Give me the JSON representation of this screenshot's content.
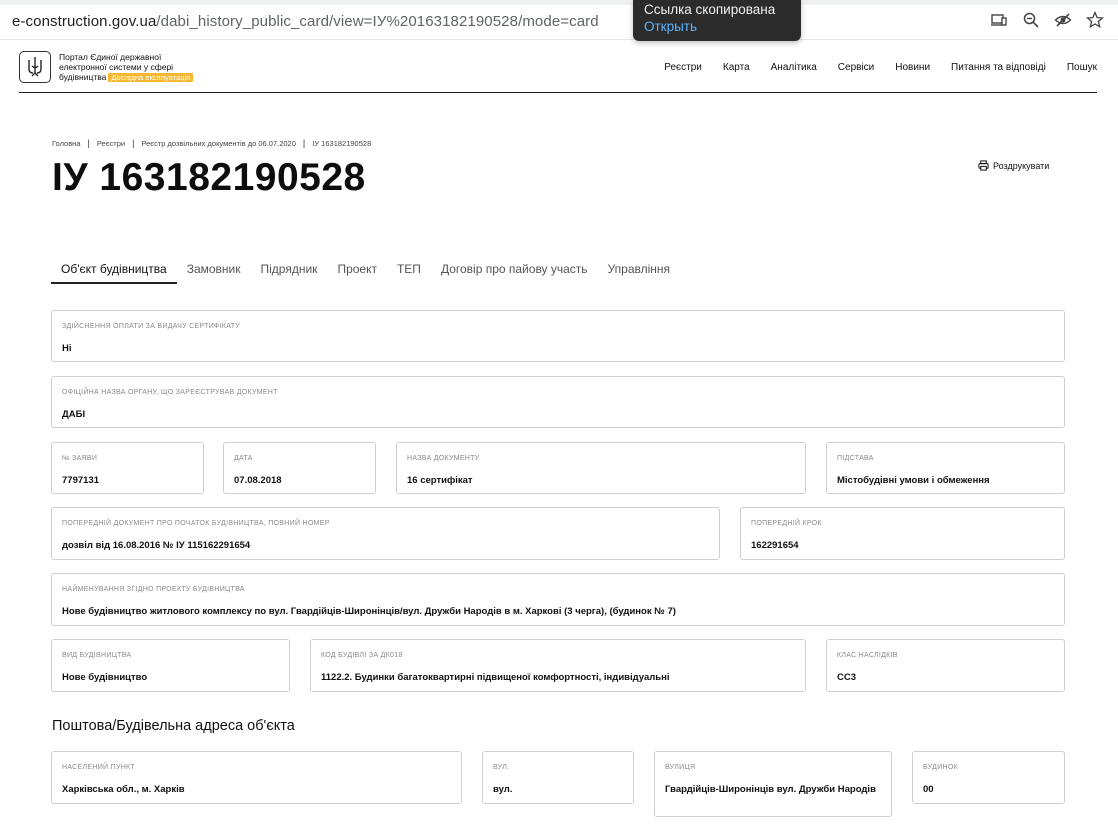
{
  "browser": {
    "url_host": "e-construction.gov.ua",
    "url_path": "/dabi_history_public_card/view=ІУ%20163182190528/mode=card",
    "toast": {
      "message": "Ссылка скопирована",
      "action": "Открыть"
    }
  },
  "header": {
    "portal_line1": "Портал Єдиної державної",
    "portal_line2": "електронної системи у сфері",
    "portal_line3": "будівництва",
    "badge": "Дослідна експлуатація",
    "nav": [
      "Реєстри",
      "Карта",
      "Аналітика",
      "Сервіси",
      "Новини",
      "Питання та відповіді",
      "Пошук"
    ]
  },
  "breadcrumb": [
    "Головна",
    "Реєстри",
    "Реєстр дозвільних документів до 06.07.2020",
    "ІУ 163182190528"
  ],
  "page_title": "ІУ 163182190528",
  "print_label": "Роздрукувати",
  "tabs": [
    "Об'єкт будівництва",
    "Замовник",
    "Підрядник",
    "Проект",
    "ТЕП",
    "Договір про пайову участь",
    "Управління"
  ],
  "fields": {
    "payment": {
      "label": "Здійснення оплати за видачу сертифікату",
      "value": "Ні"
    },
    "authority": {
      "label": "Офіційна назва органу, що зареєстрував документ",
      "value": "ДАБІ"
    },
    "application_no": {
      "label": "№ заяви",
      "value": "7797131"
    },
    "date": {
      "label": "Дата",
      "value": "07.08.2018"
    },
    "doc_name": {
      "label": "Назва документу",
      "value": "16 сертифікат"
    },
    "basis": {
      "label": "Підстава",
      "value": "Містобудівні умови і обмеження"
    },
    "prev_doc": {
      "label": "Попередній документ про початок будівництва, повний номер",
      "value": "дозвіл від 16.08.2016 № ІУ 115162291654"
    },
    "prev_step": {
      "label": "Попередній крок",
      "value": "162291654"
    },
    "project_name": {
      "label": "Найменування згідно проекту будівництва",
      "value": "Нове будівництво житлового комплексу по вул. Гвардійців-Широнінців/вул. Дружби Народів в м. Харкові (3 черга), (будинок № 7)"
    },
    "construction_type": {
      "label": "Вид будівництва",
      "value": "Нове будівництво"
    },
    "building_code": {
      "label": "Код будівлі за ДК018",
      "value": "1122.2. Будинки багатоквартирні підвищеної комфортності, індивідуальні"
    },
    "consequence_class": {
      "label": "Клас наслідків",
      "value": "СС3"
    }
  },
  "address_section": {
    "title": "Поштова/Будівельна адреса об'єкта",
    "locality": {
      "label": "Населений пункт",
      "value": "Харківська обл., м. Харків"
    },
    "street_type": {
      "label": "Вул.",
      "value": "вул."
    },
    "street": {
      "label": "Вулиця",
      "value": "Гвардійців-Широнінців вул. Дружби Народів"
    },
    "building": {
      "label": "Будинок",
      "value": "00"
    }
  }
}
